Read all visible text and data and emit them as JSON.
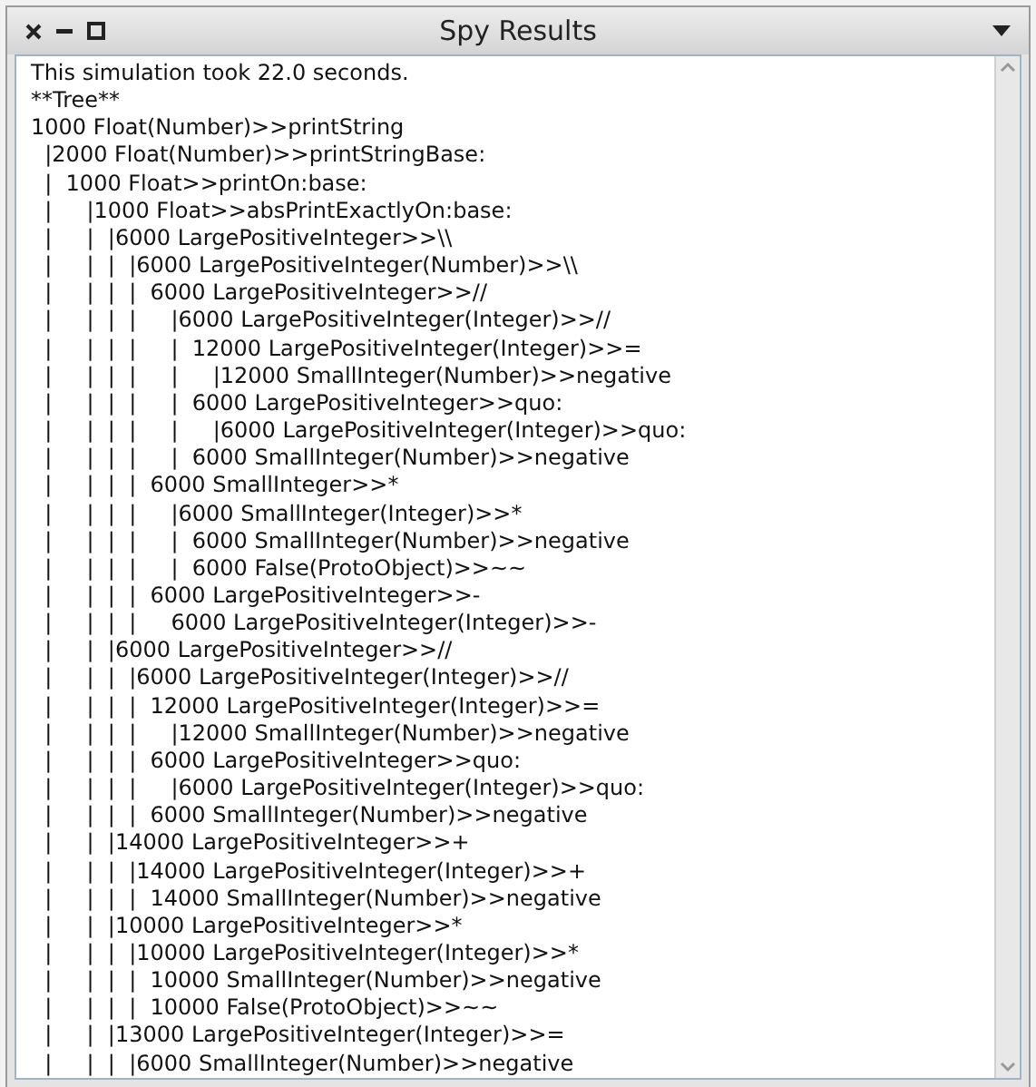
{
  "window": {
    "title": "Spy Results"
  },
  "lines": [
    "This simulation took 22.0 seconds.",
    "**Tree**",
    "1000 Float(Number)>>printString",
    "  |2000 Float(Number)>>printStringBase:",
    "  |  1000 Float>>printOn:base:",
    "  |     |1000 Float>>absPrintExactlyOn:base:",
    "  |     |  |6000 LargePositiveInteger>>\\\\",
    "  |     |  |  |6000 LargePositiveInteger(Number)>>\\\\",
    "  |     |  |  |  6000 LargePositiveInteger>>//",
    "  |     |  |  |     |6000 LargePositiveInteger(Integer)>>//",
    "  |     |  |  |     |  12000 LargePositiveInteger(Integer)>>=",
    "  |     |  |  |     |     |12000 SmallInteger(Number)>>negative",
    "  |     |  |  |     |  6000 LargePositiveInteger>>quo:",
    "  |     |  |  |     |     |6000 LargePositiveInteger(Integer)>>quo:",
    "  |     |  |  |     |  6000 SmallInteger(Number)>>negative",
    "  |     |  |  |  6000 SmallInteger>>*",
    "  |     |  |  |     |6000 SmallInteger(Integer)>>*",
    "  |     |  |  |     |  6000 SmallInteger(Number)>>negative",
    "  |     |  |  |     |  6000 False(ProtoObject)>>~~",
    "  |     |  |  |  6000 LargePositiveInteger>>-",
    "  |     |  |  |     6000 LargePositiveInteger(Integer)>>-",
    "  |     |  |6000 LargePositiveInteger>>//",
    "  |     |  |  |6000 LargePositiveInteger(Integer)>>//",
    "  |     |  |  |  12000 LargePositiveInteger(Integer)>>=",
    "  |     |  |  |     |12000 SmallInteger(Number)>>negative",
    "  |     |  |  |  6000 LargePositiveInteger>>quo:",
    "  |     |  |  |     |6000 LargePositiveInteger(Integer)>>quo:",
    "  |     |  |  |  6000 SmallInteger(Number)>>negative",
    "  |     |  |14000 LargePositiveInteger>>+",
    "  |     |  |  |14000 LargePositiveInteger(Integer)>>+",
    "  |     |  |  |  14000 SmallInteger(Number)>>negative",
    "  |     |  |10000 LargePositiveInteger>>*",
    "  |     |  |  |10000 LargePositiveInteger(Integer)>>*",
    "  |     |  |  |  10000 SmallInteger(Number)>>negative",
    "  |     |  |  |  10000 False(ProtoObject)>>~~",
    "  |     |  |13000 LargePositiveInteger(Integer)>>=",
    "  |     |  |  |6000 SmallInteger(Number)>>negative"
  ]
}
